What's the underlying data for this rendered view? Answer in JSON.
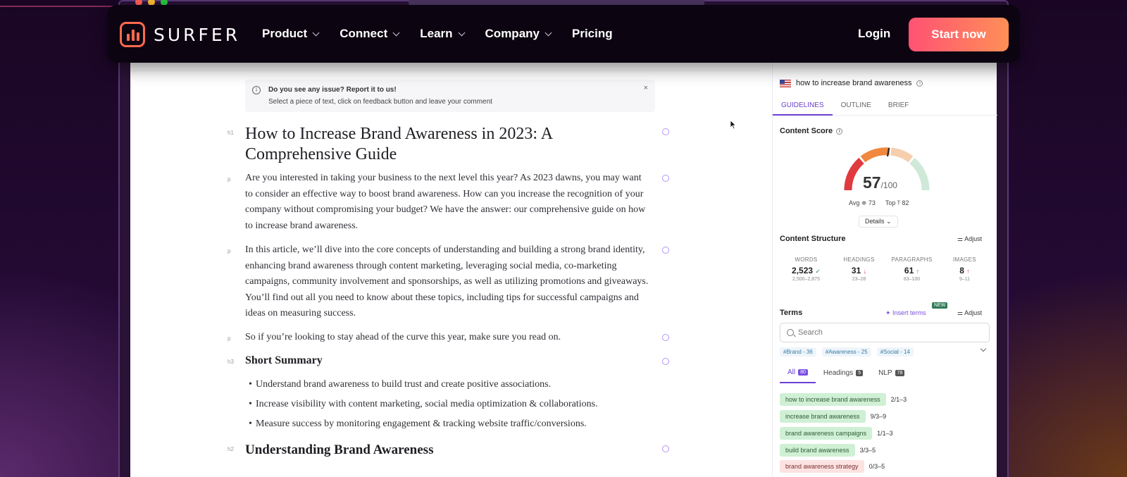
{
  "nav": {
    "logo_text": "SURFER",
    "menu": [
      {
        "label": "Product"
      },
      {
        "label": "Connect"
      },
      {
        "label": "Learn"
      },
      {
        "label": "Company"
      },
      {
        "label": "Pricing"
      }
    ],
    "login": "Login",
    "cta": "Start now"
  },
  "notice": {
    "title": "Do you see any issue? Report it to us!",
    "body": "Select a piece of text, click on feedback button and leave your comment",
    "close": "×"
  },
  "editor": {
    "tags": {
      "h1": "h1",
      "p": "p",
      "h3": "h3",
      "h2": "h2"
    },
    "title": "How to Increase Brand Awareness in 2023: A Comprehensive Guide",
    "paragraphs": [
      "Are you interested in taking your business to the next level this year? As 2023 dawns, you may want to consider an effective way to boost brand awareness. How can you increase the recognition of your company without compromising your budget? We have the answer: our comprehensive guide on how to increase brand awareness.",
      "In this article, we’ll dive into the core concepts of understanding and building a strong brand identity, enhancing brand awareness through content marketing, leveraging social media, co-marketing campaigns, community involvement and sponsorships, as well as utilizing promotions and giveaways. You’ll find out all you need to know about these topics, including tips for successful campaigns and ideas on measuring success.",
      "So if you’re looking to stay ahead of the curve this year, make sure you read on."
    ],
    "summary_heading": "Short Summary",
    "bullets": [
      "Understand brand awareness to build trust and create positive associations.",
      "Increase visibility with content marketing, social media optimization & collaborations.",
      "Measure success by monitoring engagement & tracking website traffic/conversions."
    ],
    "section_heading": "Understanding Brand Awareness"
  },
  "sidebar": {
    "keyword": "how to increase brand awareness",
    "tabs": [
      "GUIDELINES",
      "OUTLINE",
      "BRIEF"
    ],
    "content_score_label": "Content Score",
    "score": "57",
    "score_max": "/100",
    "avg": "Avg ≑ 73",
    "top": "Top ⤒ 82",
    "details": "Details ⌄",
    "structure_title": "Content Structure",
    "adjust": "Adjust",
    "metrics": [
      {
        "label": "WORDS",
        "value": "2,523",
        "mark": "✓",
        "range": "2,500–2,875"
      },
      {
        "label": "HEADINGS",
        "value": "31",
        "mark": "↓",
        "range": "23–28"
      },
      {
        "label": "PARAGRAPHS",
        "value": "61",
        "mark": "↑",
        "range": "83–100"
      },
      {
        "label": "IMAGES",
        "value": "8",
        "mark": "↑",
        "range": "9–11"
      }
    ],
    "terms_title": "Terms",
    "insert_terms": "Insert terms",
    "new_badge": "NEW",
    "search_placeholder": "Search",
    "chips": [
      "#Brand - 36",
      "#Awareness - 25",
      "#Social - 14"
    ],
    "filter_tabs": [
      {
        "label": "All",
        "count": "80"
      },
      {
        "label": "Headings",
        "count": "5"
      },
      {
        "label": "NLP",
        "count": "78"
      }
    ],
    "terms": [
      {
        "name": "how to increase brand awareness",
        "count": "2/1–3"
      },
      {
        "name": "increase brand awareness",
        "count": "9/3–9"
      },
      {
        "name": "brand awareness campaigns",
        "count": "1/1–3"
      },
      {
        "name": "build brand awareness",
        "count": "3/3–5"
      },
      {
        "name": "brand awareness strategy",
        "count": "0/3–5"
      }
    ],
    "colors": {
      "accent": "#6b3fd4",
      "gauge_red": "#e0393e",
      "gauge_orange": "#f0883e",
      "gauge_light": "#f6cfae",
      "gauge_green": "#cfe9d8"
    }
  }
}
